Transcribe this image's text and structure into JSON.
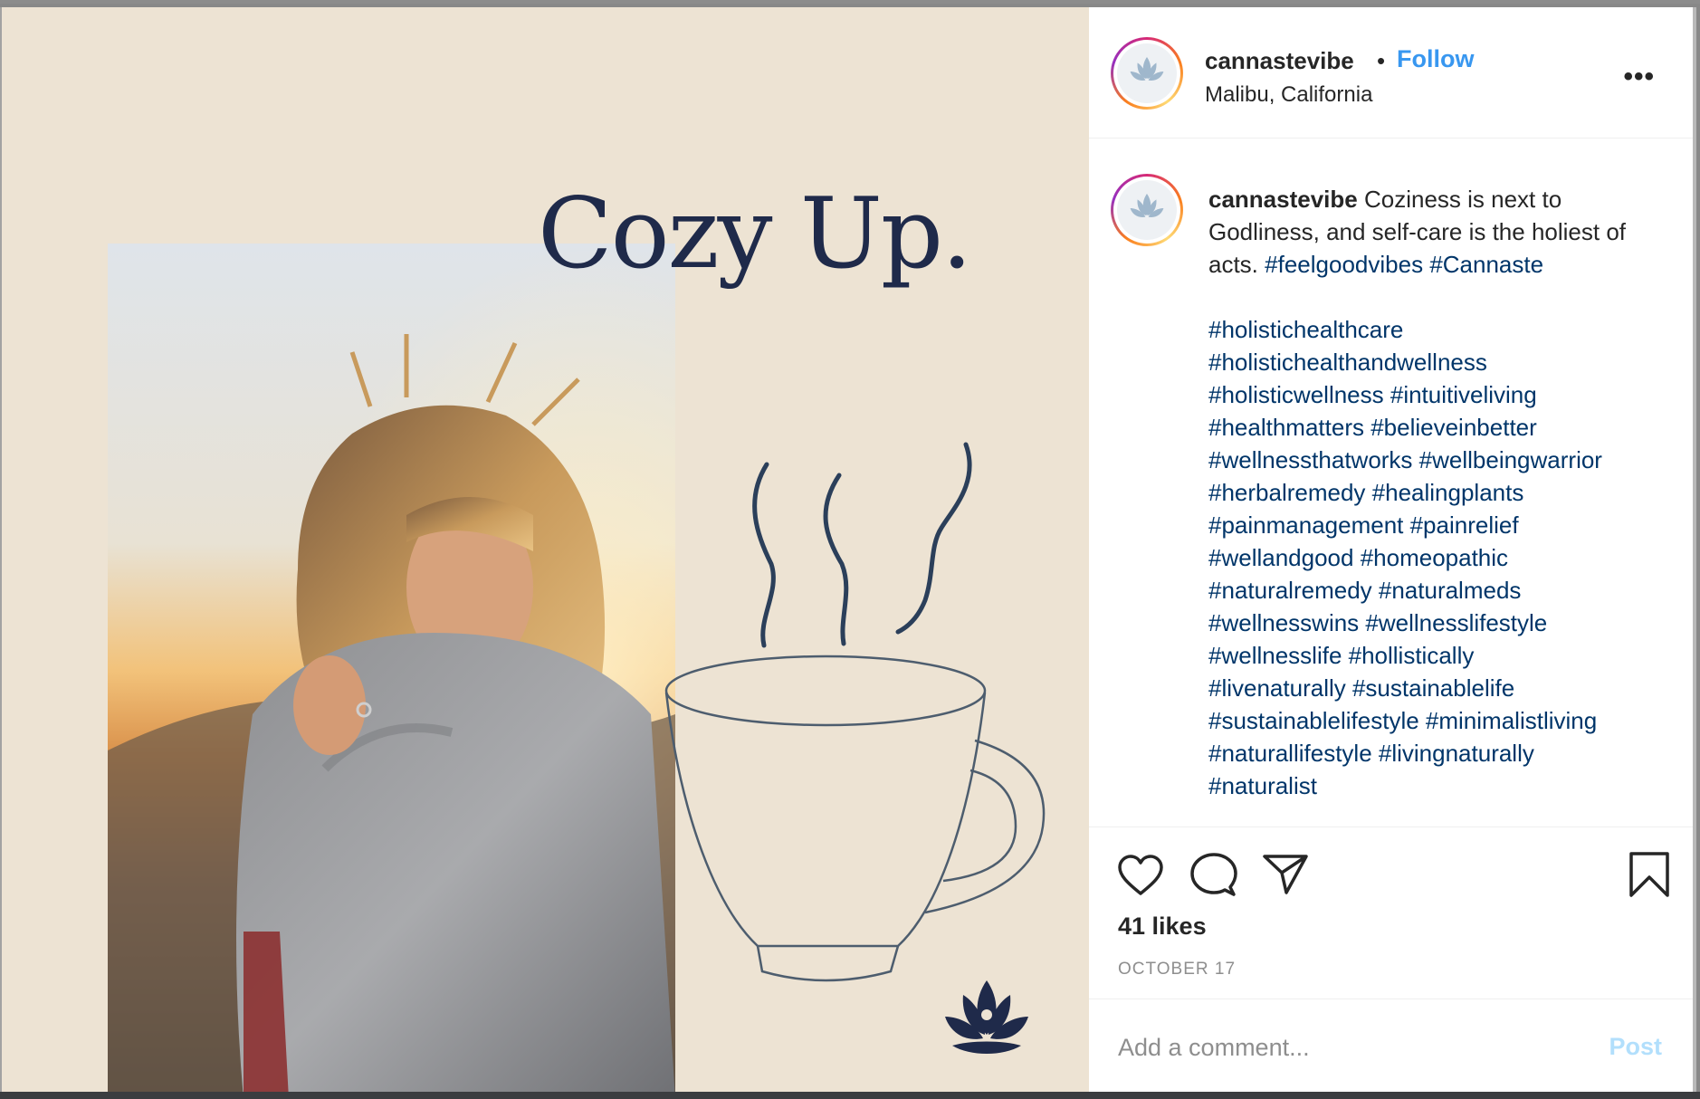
{
  "post": {
    "headline": "Cozy Up."
  },
  "header": {
    "username": "cannastevibe",
    "separator": "•",
    "follow_label": "Follow",
    "location": "Malibu, California",
    "more_label": "•••"
  },
  "caption": {
    "username": "cannastevibe",
    "text": "Coziness is next to Godliness, and self-care is the holiest of acts.",
    "inline_tags": [
      "#feelgoodvibes",
      "#Cannaste"
    ],
    "tag_lines": [
      "#holistichealthcare",
      "#holistichealthandwellness",
      "#holisticwellness #intuitiveliving",
      "#healthmatters #believeinbetter",
      "#wellnessthatworks #wellbeingwarrior",
      "#herbalremedy #healingplants",
      "#painmanagement #painrelief",
      "#wellandgood #homeopathic",
      "#naturalremedy #naturalmeds",
      "#wellnesswins #wellnesslifestyle",
      "#wellnesslife #hollistically",
      "#livenaturally #sustainablelife",
      "#sustainablelifestyle #minimalistliving",
      "#naturallifestyle #livingnaturally",
      "#naturalist"
    ]
  },
  "actions": {
    "icons": [
      "heart-icon",
      "comment-icon",
      "share-icon",
      "bookmark-icon"
    ],
    "likes": "41 likes",
    "date": "OCTOBER 17"
  },
  "comment": {
    "placeholder": "Add a comment...",
    "post_label": "Post"
  },
  "colors": {
    "follow": "#3897f0",
    "hashtag": "#003569",
    "post_disabled": "#b2dffc",
    "image_background": "#ede3d3",
    "headline": "#1f2a4a"
  }
}
